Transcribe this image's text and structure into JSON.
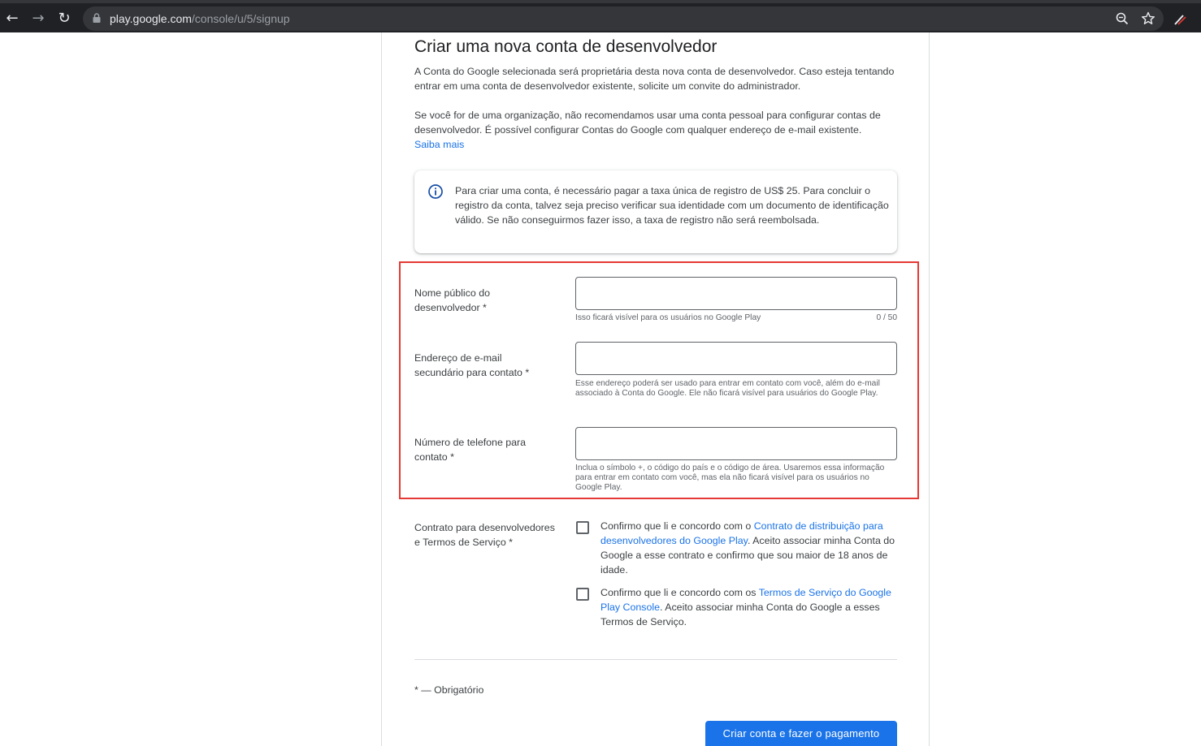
{
  "browser": {
    "url_host": "play.google.com",
    "url_path": "/console/u/5/signup",
    "back_glyph": "←",
    "forward_glyph": "→",
    "reload_glyph": "↻"
  },
  "page": {
    "title": "Criar uma nova conta de desenvolvedor",
    "intro_1": "A Conta do Google selecionada será proprietária desta nova conta de desenvolvedor. Caso esteja tentando entrar em uma conta de desenvolvedor existente, solicite um convite do administrador.",
    "intro_2": "Se você for de uma organização, não recomendamos usar uma conta pessoal para configurar contas de desenvolvedor. É possível configurar Contas do Google com qualquer endereço de e-mail existente.",
    "learn_more": "Saiba mais",
    "info_text": "Para criar uma conta, é necessário pagar a taxa única de registro de US$ 25. Para concluir o registro da conta, talvez seja preciso verificar sua identidade com um documento de identificação válido. Se não conseguirmos fazer isso, a taxa de registro não será reembolsada."
  },
  "form": {
    "developer_name": {
      "label": "Nome público do desenvolvedor  *",
      "value": "",
      "helper": "Isso ficará visível para os usuários no Google Play",
      "counter": "0 / 50"
    },
    "contact_email": {
      "label": "Endereço de e-mail secundário para contato  *",
      "value": "",
      "helper": "Esse endereço poderá ser usado para entrar em contato com você, além do e-mail associado à Conta do Google. Ele não ficará visível para usuários do Google Play."
    },
    "contact_phone": {
      "label": "Número de telefone para contato  *",
      "value": "",
      "helper": "Inclua o símbolo +, o código do país e o código de área. Usaremos essa informação para entrar em contato com você, mas ela não ficará visível para os usuários no Google Play."
    },
    "agreement": {
      "label": "Contrato para desenvolvedores e Termos de Serviço  *",
      "check_1_before": "Confirmo que li e concordo com o ",
      "check_1_link": "Contrato de distribuição para desenvolvedores do Google Play",
      "check_1_after": ". Aceito associar minha Conta do Google a esse contrato e confirmo que sou maior de 18 anos de idade.",
      "check_1_checked": false,
      "check_2_before": "Confirmo que li e concordo com os ",
      "check_2_link": "Termos de Serviço do Google Play Console",
      "check_2_after": ". Aceito associar minha Conta do Google a esses Termos de Serviço.",
      "check_2_checked": false
    },
    "required_note": "* — Obrigatório",
    "submit_label": "Criar conta e fazer o pagamento"
  },
  "colors": {
    "accent": "#1a73e8",
    "highlight_border": "#e53935",
    "chrome_bg": "#202124"
  },
  "icons": [
    "back-arrow-icon",
    "forward-arrow-icon",
    "reload-icon",
    "lock-icon",
    "zoom-icon",
    "star-icon",
    "extension-icon",
    "info-icon"
  ]
}
